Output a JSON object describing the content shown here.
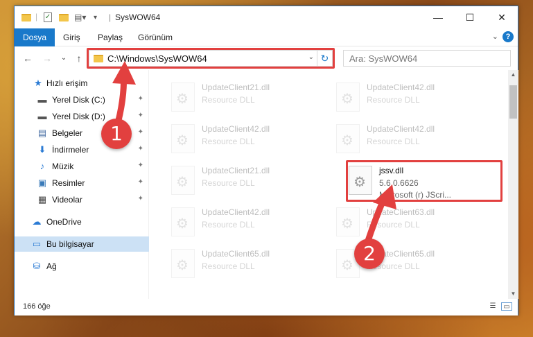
{
  "window": {
    "title": "SysWOW64",
    "controls": {
      "minimize": "—",
      "maximize": "☐",
      "close": "✕"
    }
  },
  "ribbon": {
    "tabs": [
      {
        "label": "Dosya",
        "active": true
      },
      {
        "label": "Giriş"
      },
      {
        "label": "Paylaş"
      },
      {
        "label": "Görünüm"
      }
    ],
    "expand": "⌄",
    "help": "?"
  },
  "nav": {
    "back": "←",
    "forward": "→",
    "recent": "⌄",
    "up": "↑",
    "address": "C:\\Windows\\SysWOW64",
    "address_dropdown": "⌄",
    "refresh": "↻",
    "search_placeholder": "Ara: SysWOW64"
  },
  "sidebar": {
    "items": [
      {
        "label": "Hızlı erişim",
        "icon": "star-icon",
        "glyph": "★",
        "color": "#2b7bd4",
        "pinned": false
      },
      {
        "label": "Yerel Disk (C:)",
        "icon": "drive-icon",
        "glyph": "▬",
        "color": "#555555",
        "pinned": true
      },
      {
        "label": "Yerel Disk (D:)",
        "icon": "drive-icon",
        "glyph": "▬",
        "color": "#555555",
        "pinned": true
      },
      {
        "label": "Belgeler",
        "icon": "documents-icon",
        "glyph": "▤",
        "color": "#4a6fa5",
        "pinned": true
      },
      {
        "label": "İndirmeler",
        "icon": "download-icon",
        "glyph": "⬇",
        "color": "#2b7bd4",
        "pinned": true
      },
      {
        "label": "Müzik",
        "icon": "music-icon",
        "glyph": "♪",
        "color": "#2b7bd4",
        "pinned": true
      },
      {
        "label": "Resimler",
        "icon": "pictures-icon",
        "glyph": "▣",
        "color": "#3a7ab8",
        "pinned": true
      },
      {
        "label": "Videolar",
        "icon": "videos-icon",
        "glyph": "▦",
        "color": "#444444",
        "pinned": true
      },
      {
        "label": "OneDrive",
        "icon": "cloud-icon",
        "glyph": "☁",
        "color": "#2b7bd4",
        "pinned": false
      },
      {
        "label": "Bu bilgisayar",
        "icon": "computer-icon",
        "glyph": "▭",
        "color": "#2b7bd4",
        "pinned": false,
        "selected": true
      },
      {
        "label": "Ağ",
        "icon": "network-icon",
        "glyph": "⛁",
        "color": "#2b7bd4",
        "pinned": false
      }
    ],
    "pin_glyph": "📌"
  },
  "files": [
    {
      "name": "UpdateClient21.dll",
      "desc": "Resource DLL",
      "faded": true
    },
    {
      "name": "UpdateClient42.dll",
      "desc": "Resource DLL",
      "faded": true
    },
    {
      "name": "UpdateClient42.dll",
      "desc": "Resource DLL",
      "faded": true
    },
    {
      "name": "UpdateClient42.dll",
      "desc": "Resource DLL",
      "faded": true
    },
    {
      "name": "UpdateClient21.dll",
      "desc": "Resource DLL",
      "faded": true
    },
    {
      "name": "jssv.dll",
      "version": "5.6.0.6626",
      "company": "Microsoft (r) JScri...",
      "faded": false
    },
    {
      "name": "UpdateClient42.dll",
      "desc": "Resource DLL",
      "faded": true
    },
    {
      "name": "UpdateClient63.dll",
      "desc": "Resource DLL",
      "faded": true
    },
    {
      "name": "UpdateClient65.dll",
      "desc": "Resource DLL",
      "faded": true
    },
    {
      "name": "UpdateClient65.dll",
      "desc": "Resource DLL",
      "faded": true
    }
  ],
  "status": {
    "item_count": "166 öğe"
  },
  "annotations": {
    "step1": "1",
    "step2": "2",
    "color": "#e2403f"
  }
}
